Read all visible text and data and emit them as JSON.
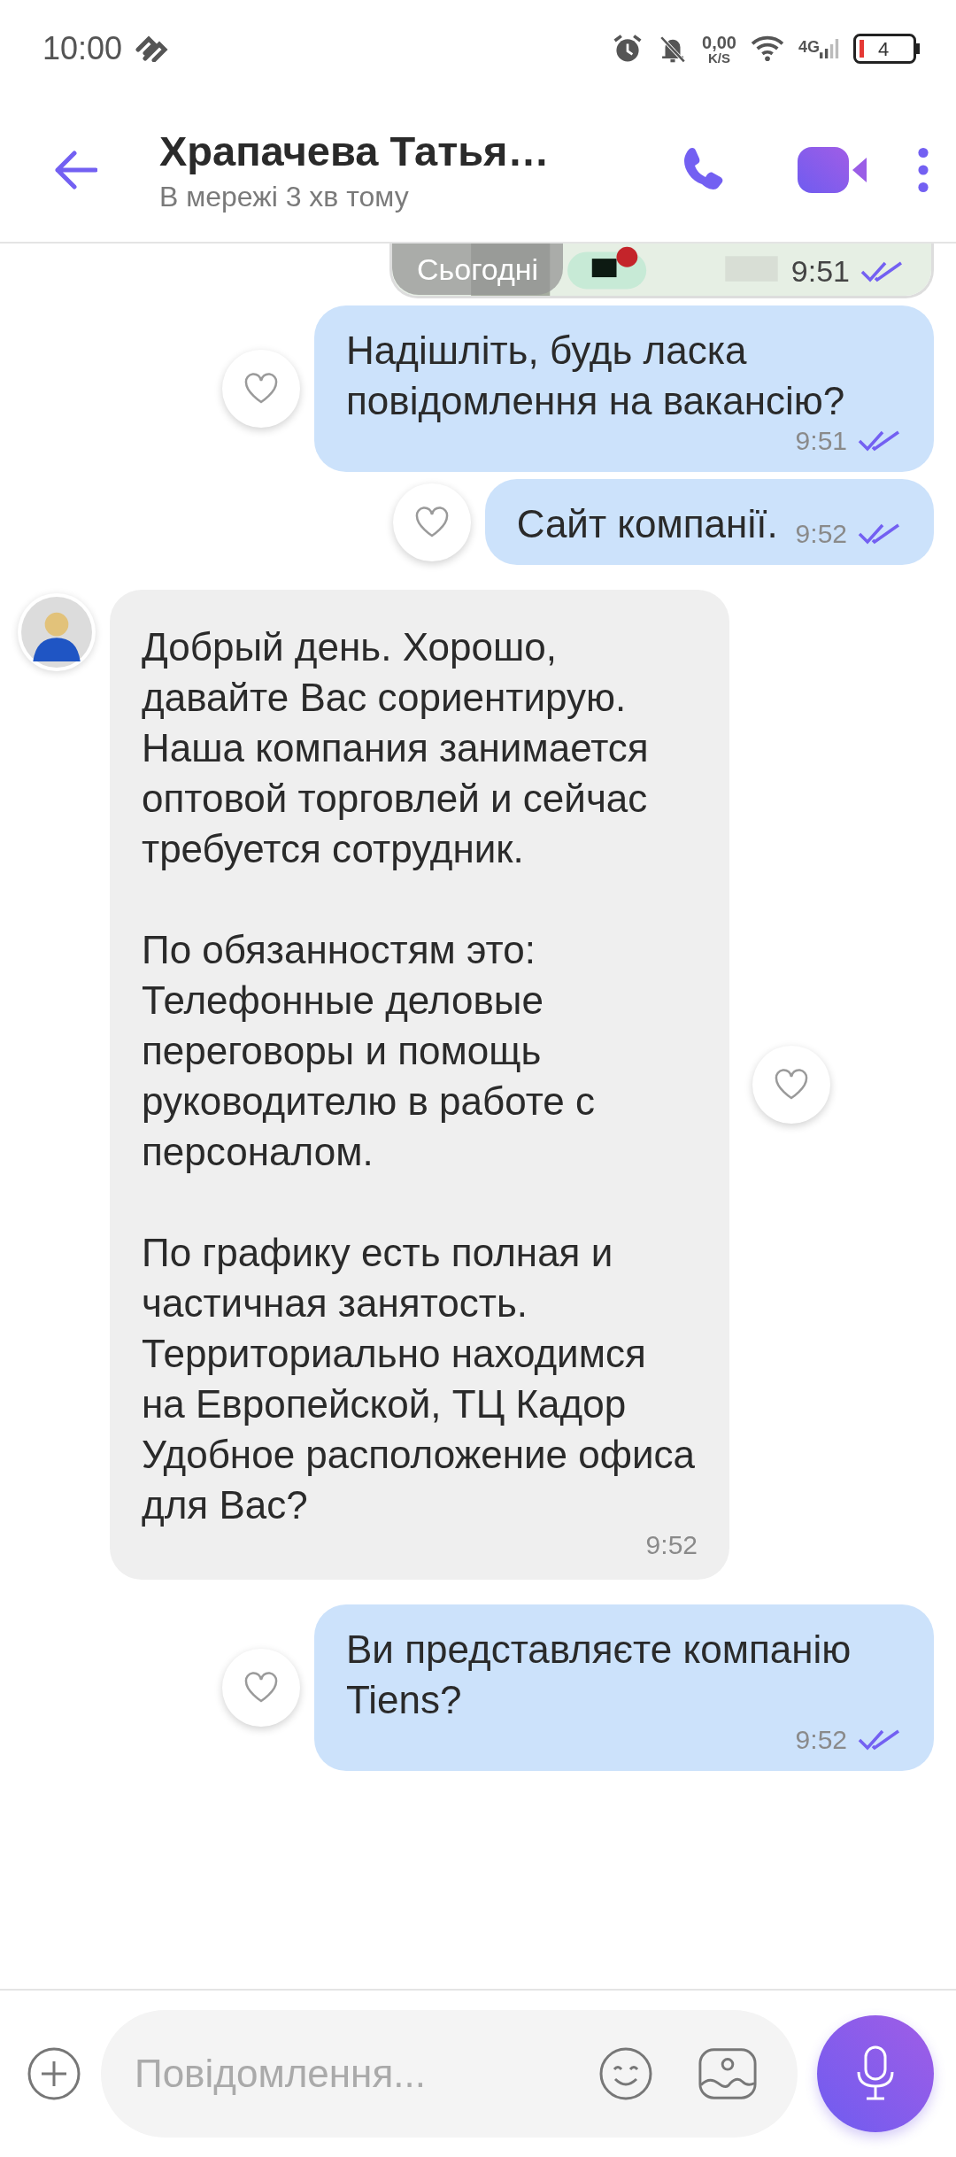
{
  "status_bar": {
    "time": "10:00",
    "net_speed": "0,00",
    "net_unit": "K/S",
    "network": "4G",
    "battery": "4"
  },
  "header": {
    "title": "Храпачева Татья…",
    "subtitle": "В мережі 3 хв тому"
  },
  "messages": [
    {
      "outgoing": true,
      "date_chip": "Сьогодні",
      "time": "9:51",
      "read": true
    },
    {
      "kind": "text",
      "outgoing": true,
      "text": "Надішліть, будь ласка повідомлення на вакансію?",
      "time": "9:51",
      "read": true
    },
    {
      "kind": "text",
      "outgoing": true,
      "text": "Сайт компанії.",
      "time": "9:52",
      "read": true
    },
    {
      "kind": "text",
      "outgoing": false,
      "text": "Добрый день. Хорошо, давайте Вас сориентирую. Наша компания занимается оптовой торговлей и сейчас требуется сотрудник.\n\nПо обязанностям это:\nТелефонные деловые переговоры и помощь руководителю в работе с персоналом.\n\nПо графику есть полная и частичная занятость. Территориально находимся на Европейской, ТЦ Кадор\nУдобное расположение офиса для Вас?",
      "time": "9:52"
    },
    {
      "kind": "text",
      "outgoing": true,
      "text": "Ви представляєте компанію Tiens?",
      "time": "9:52",
      "read": true
    }
  ],
  "composer": {
    "placeholder": "Повідомлення..."
  }
}
